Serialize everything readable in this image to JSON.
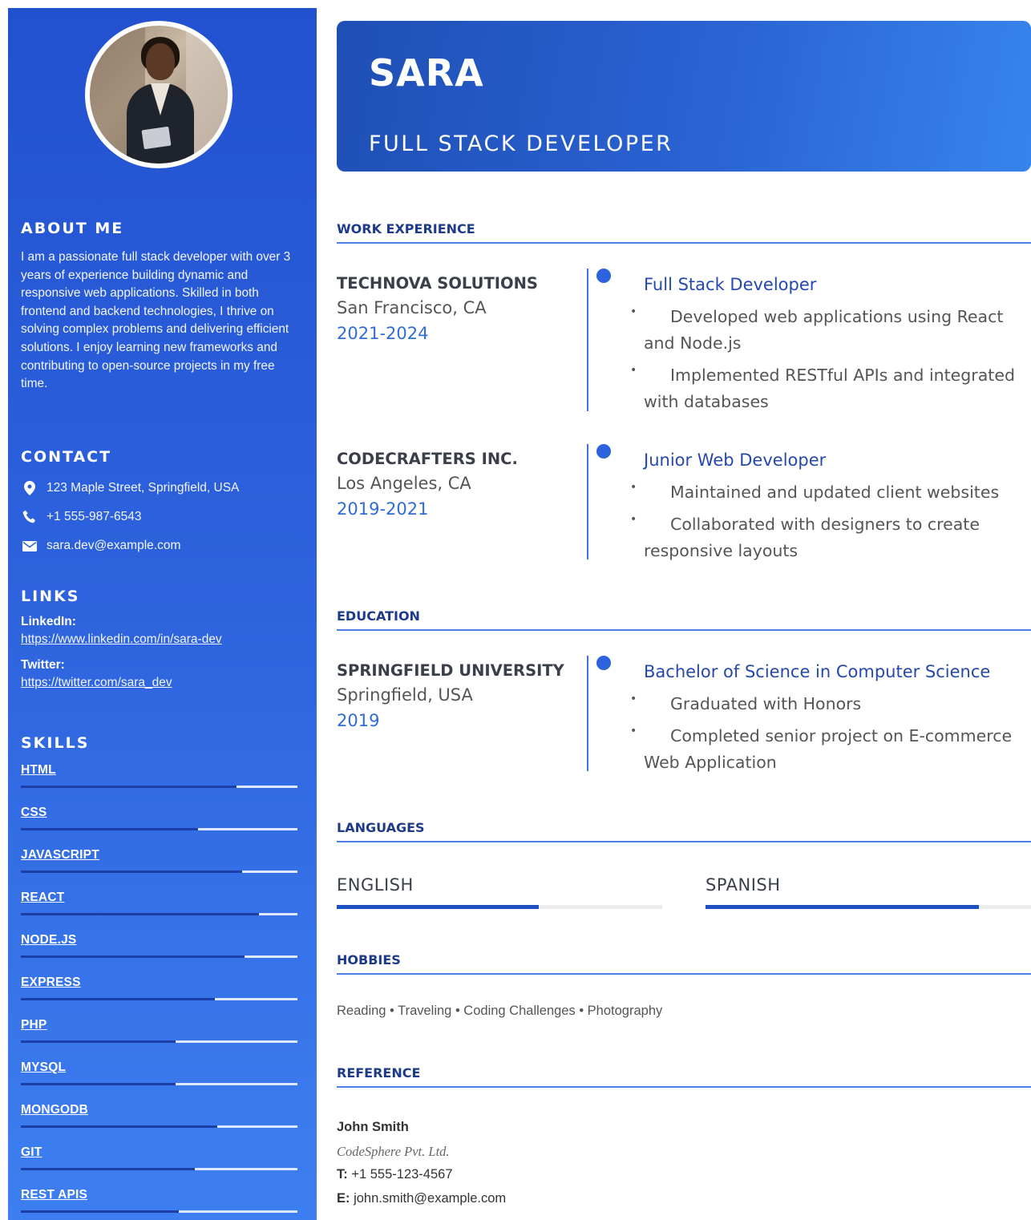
{
  "profile": {
    "name": "SARA",
    "title": "FULL STACK DEVELOPER"
  },
  "sidebar": {
    "about": {
      "heading": "ABOUT ME",
      "text": "I am a passionate full stack developer with over 3 years of experience building dynamic and responsive web applications. Skilled in both frontend and backend technologies, I thrive on solving complex problems and delivering efficient solutions. I enjoy learning new frameworks and contributing to open-source projects in my free time."
    },
    "contact": {
      "heading": "CONTACT",
      "address": "123 Maple Street, Springfield, USA",
      "phone": "+1 555-987-6543",
      "email": "sara.dev@example.com"
    },
    "links": {
      "heading": "LINKS",
      "linkedin_label": "LinkedIn:",
      "linkedin_url": "https://www.linkedin.com/in/sara-dev",
      "twitter_label": "Twitter:",
      "twitter_url": "https://twitter.com/sara_dev"
    },
    "skills": {
      "heading": "SKILLS",
      "items": [
        {
          "name": "HTML",
          "level": 0.78
        },
        {
          "name": "CSS",
          "level": 0.64
        },
        {
          "name": "JAVASCRIPT",
          "level": 0.8
        },
        {
          "name": "REACT",
          "level": 0.86
        },
        {
          "name": "NODE.JS",
          "level": 0.81
        },
        {
          "name": "EXPRESS",
          "level": 0.7
        },
        {
          "name": "PHP",
          "level": 0.56
        },
        {
          "name": "MYSQL",
          "level": 0.56
        },
        {
          "name": "MONGODB",
          "level": 0.71
        },
        {
          "name": "GIT",
          "level": 0.63
        },
        {
          "name": "REST APIS",
          "level": 0.57
        }
      ]
    }
  },
  "main": {
    "work": {
      "heading": "WORK EXPERIENCE",
      "entries": [
        {
          "company": "TECHNOVA SOLUTIONS",
          "location": "San Francisco, CA",
          "years": "2021-2024",
          "role": "Full Stack Developer",
          "bullets": [
            "Developed web applications using React and Node.js",
            "Implemented RESTful APIs and integrated with databases"
          ]
        },
        {
          "company": "CODECRAFTERS INC.",
          "location": "Los Angeles, CA",
          "years": "2019-2021",
          "role": "Junior Web Developer",
          "bullets": [
            "Maintained and updated client websites",
            "Collaborated with designers to create responsive layouts"
          ]
        }
      ]
    },
    "education": {
      "heading": "EDUCATION",
      "entries": [
        {
          "school": "SPRINGFIELD UNIVERSITY",
          "location": "Springfield, USA",
          "year": "2019",
          "degree": "Bachelor of Science in Computer Science",
          "bullets": [
            "Graduated with Honors",
            "Completed senior project on E-commerce Web Application"
          ]
        }
      ]
    },
    "languages": {
      "heading": "LANGUAGES",
      "items": [
        {
          "name": "ENGLISH",
          "level": 0.62
        },
        {
          "name": "SPANISH",
          "level": 0.84
        }
      ]
    },
    "hobbies": {
      "heading": "HOBBIES",
      "text": "Reading • Traveling • Coding Challenges • Photography"
    },
    "reference": {
      "heading": "REFERENCE",
      "name": "John Smith",
      "company": "CodeSphere Pvt. Ltd.",
      "phone_label": "T:",
      "phone": "+1 555-123-4567",
      "email_label": "E:",
      "email": "john.smith@example.com"
    }
  },
  "colors": {
    "sidebar_top": "#2251d0",
    "sidebar_bottom": "#3d7ff0",
    "accent": "#2d63dd",
    "heading_blue": "#1e3b8a",
    "skill_fill": "#1c3ea8"
  },
  "icons": [
    "location-pin-icon",
    "phone-icon",
    "mail-icon"
  ]
}
